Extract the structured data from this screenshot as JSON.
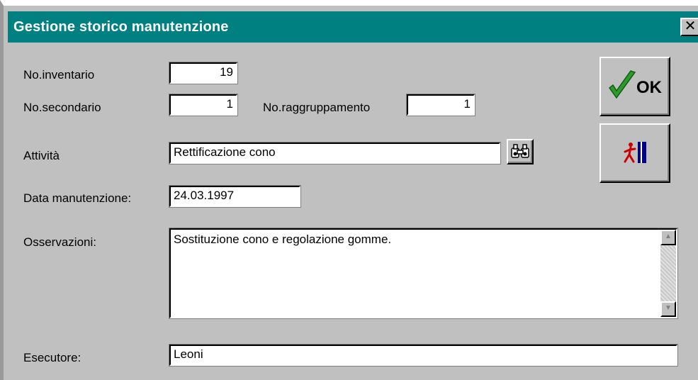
{
  "window": {
    "title": "Gestione storico manutenzione",
    "close_glyph": "✕"
  },
  "form": {
    "inventario_label": "No.inventario",
    "inventario_value": "19",
    "secondario_label": "No.secondario",
    "secondario_value": "1",
    "raggruppamento_label": "No.raggruppamento",
    "raggruppamento_value": "1",
    "attivita_label": "Attività",
    "attivita_value": "Rettificazione cono",
    "data_label": "Data manutenzione:",
    "data_value": "24.03.1997",
    "osservazioni_label": "Osservazioni:",
    "osservazioni_value": "Sostituzione cono e regolazione gomme.",
    "esecutore_label": "Esecutore:",
    "esecutore_value": "Leoni"
  },
  "buttons": {
    "ok_label": "OK",
    "ok_icon": "checkmark-icon",
    "exit_icon": "exit-door-icon",
    "lookup_icon": "binoculars-icon"
  },
  "colors": {
    "titlebar": "#008080",
    "checkmark": "#2e9a2e",
    "exit": "#cc0000"
  }
}
